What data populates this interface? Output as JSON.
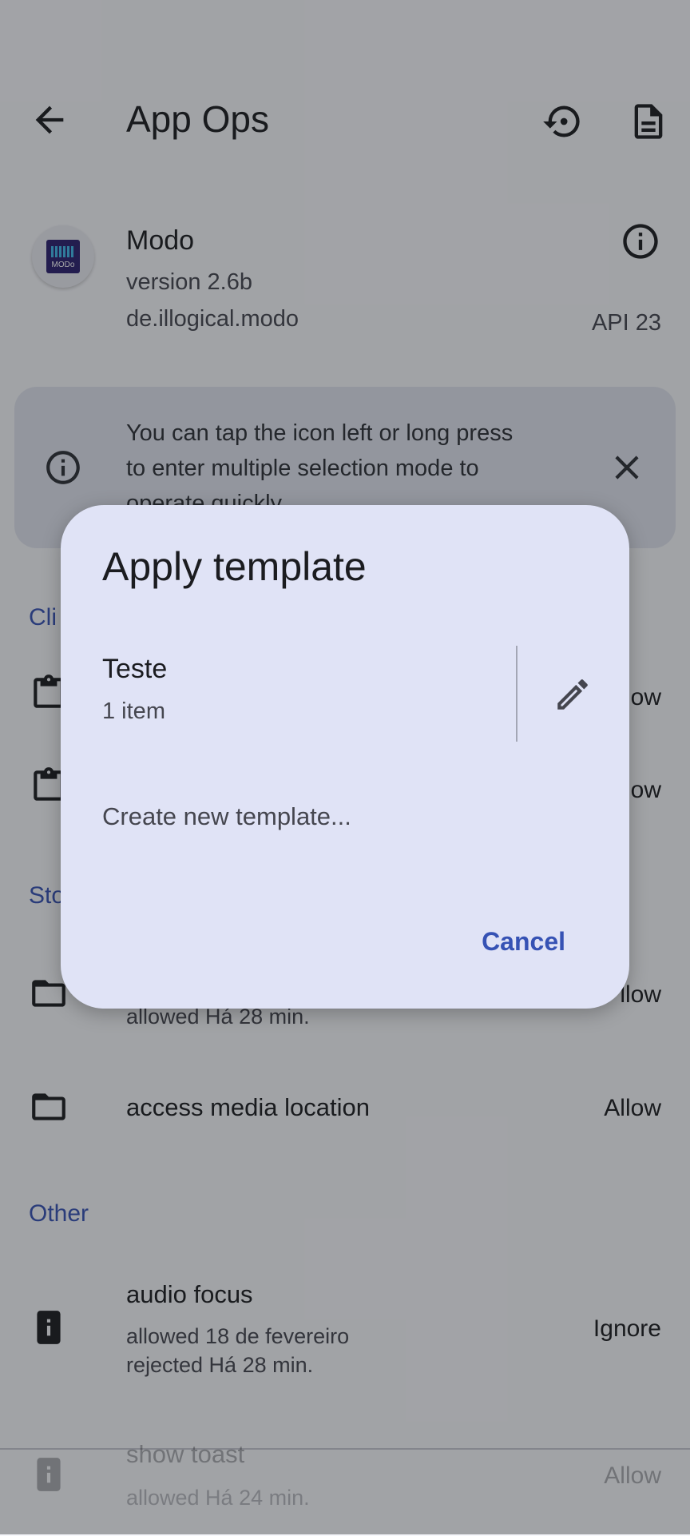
{
  "toolbar": {
    "title": "App Ops",
    "back_icon": "arrow-back-icon",
    "reset_icon": "restore-icon",
    "log_icon": "document-icon"
  },
  "app": {
    "name": "Modo",
    "version": "version 2.6b",
    "package": "de.illogical.modo",
    "api": "API 23",
    "icon_text": "MODo"
  },
  "tip": {
    "line1": "You can tap the icon left or long press",
    "line2": "to enter multiple selection mode to",
    "line3": "operate quickly"
  },
  "sections": {
    "clipboard_partial": "Cli",
    "storage_partial": "Sto",
    "other": "Other"
  },
  "rows": {
    "clip1_value_partial": "ow",
    "clip2_value_partial": "ow",
    "storage1_sub": "allowed Há 28 min.",
    "storage1_value_partial": "llow",
    "media_title": "access media location",
    "media_value": "Allow",
    "audio_title": "audio focus",
    "audio_sub1": "allowed 18 de fevereiro",
    "audio_sub2": "rejected Há 28 min.",
    "audio_value": "Ignore",
    "toast_title": "show toast",
    "toast_sub": "allowed Há 24 min.",
    "toast_value": "Allow"
  },
  "dialog": {
    "title": "Apply template",
    "template_name": "Teste",
    "template_count": "1 item",
    "create_label": "Create new template...",
    "cancel_label": "Cancel"
  },
  "colors": {
    "accent": "#3652b4",
    "dialog_bg": "#e0e3f6",
    "tip_bg": "#dfe3ee"
  }
}
